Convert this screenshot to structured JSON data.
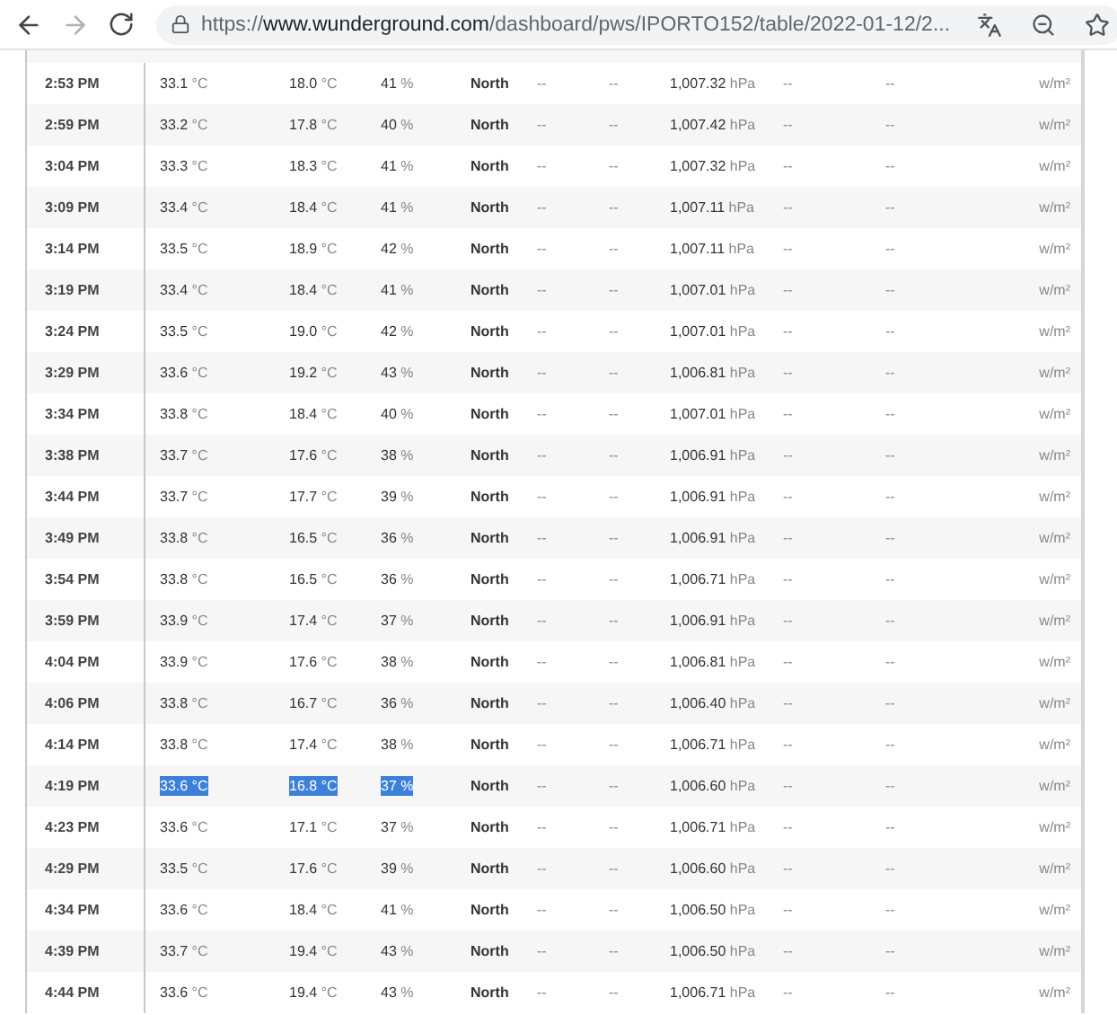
{
  "browser": {
    "url_scheme": "https://",
    "url_host": "www.wunderground.com",
    "url_path": "/dashboard/pws/IPORTO152/table/2022-01-12/2...",
    "forward_disabled": true
  },
  "table": {
    "rows": [
      {
        "time": "2:53 PM",
        "temperature": "33.1 °C",
        "dew_point": "18.0 °C",
        "humidity": "41 %",
        "wind": "North",
        "speed": "--",
        "gust": "--",
        "pressure": "1,007.32 hPa",
        "precip_rate": "--",
        "precip_accum": "--",
        "solar": "w/m²",
        "highlighted": false
      },
      {
        "time": "2:59 PM",
        "temperature": "33.2 °C",
        "dew_point": "17.8 °C",
        "humidity": "40 %",
        "wind": "North",
        "speed": "--",
        "gust": "--",
        "pressure": "1,007.42 hPa",
        "precip_rate": "--",
        "precip_accum": "--",
        "solar": "w/m²",
        "highlighted": false
      },
      {
        "time": "3:04 PM",
        "temperature": "33.3 °C",
        "dew_point": "18.3 °C",
        "humidity": "41 %",
        "wind": "North",
        "speed": "--",
        "gust": "--",
        "pressure": "1,007.32 hPa",
        "precip_rate": "--",
        "precip_accum": "--",
        "solar": "w/m²",
        "highlighted": false
      },
      {
        "time": "3:09 PM",
        "temperature": "33.4 °C",
        "dew_point": "18.4 °C",
        "humidity": "41 %",
        "wind": "North",
        "speed": "--",
        "gust": "--",
        "pressure": "1,007.11 hPa",
        "precip_rate": "--",
        "precip_accum": "--",
        "solar": "w/m²",
        "highlighted": false
      },
      {
        "time": "3:14 PM",
        "temperature": "33.5 °C",
        "dew_point": "18.9 °C",
        "humidity": "42 %",
        "wind": "North",
        "speed": "--",
        "gust": "--",
        "pressure": "1,007.11 hPa",
        "precip_rate": "--",
        "precip_accum": "--",
        "solar": "w/m²",
        "highlighted": false
      },
      {
        "time": "3:19 PM",
        "temperature": "33.4 °C",
        "dew_point": "18.4 °C",
        "humidity": "41 %",
        "wind": "North",
        "speed": "--",
        "gust": "--",
        "pressure": "1,007.01 hPa",
        "precip_rate": "--",
        "precip_accum": "--",
        "solar": "w/m²",
        "highlighted": false
      },
      {
        "time": "3:24 PM",
        "temperature": "33.5 °C",
        "dew_point": "19.0 °C",
        "humidity": "42 %",
        "wind": "North",
        "speed": "--",
        "gust": "--",
        "pressure": "1,007.01 hPa",
        "precip_rate": "--",
        "precip_accum": "--",
        "solar": "w/m²",
        "highlighted": false
      },
      {
        "time": "3:29 PM",
        "temperature": "33.6 °C",
        "dew_point": "19.2 °C",
        "humidity": "43 %",
        "wind": "North",
        "speed": "--",
        "gust": "--",
        "pressure": "1,006.81 hPa",
        "precip_rate": "--",
        "precip_accum": "--",
        "solar": "w/m²",
        "highlighted": false
      },
      {
        "time": "3:34 PM",
        "temperature": "33.8 °C",
        "dew_point": "18.4 °C",
        "humidity": "40 %",
        "wind": "North",
        "speed": "--",
        "gust": "--",
        "pressure": "1,007.01 hPa",
        "precip_rate": "--",
        "precip_accum": "--",
        "solar": "w/m²",
        "highlighted": false
      },
      {
        "time": "3:38 PM",
        "temperature": "33.7 °C",
        "dew_point": "17.6 °C",
        "humidity": "38 %",
        "wind": "North",
        "speed": "--",
        "gust": "--",
        "pressure": "1,006.91 hPa",
        "precip_rate": "--",
        "precip_accum": "--",
        "solar": "w/m²",
        "highlighted": false
      },
      {
        "time": "3:44 PM",
        "temperature": "33.7 °C",
        "dew_point": "17.7 °C",
        "humidity": "39 %",
        "wind": "North",
        "speed": "--",
        "gust": "--",
        "pressure": "1,006.91 hPa",
        "precip_rate": "--",
        "precip_accum": "--",
        "solar": "w/m²",
        "highlighted": false
      },
      {
        "time": "3:49 PM",
        "temperature": "33.8 °C",
        "dew_point": "16.5 °C",
        "humidity": "36 %",
        "wind": "North",
        "speed": "--",
        "gust": "--",
        "pressure": "1,006.91 hPa",
        "precip_rate": "--",
        "precip_accum": "--",
        "solar": "w/m²",
        "highlighted": false
      },
      {
        "time": "3:54 PM",
        "temperature": "33.8 °C",
        "dew_point": "16.5 °C",
        "humidity": "36 %",
        "wind": "North",
        "speed": "--",
        "gust": "--",
        "pressure": "1,006.71 hPa",
        "precip_rate": "--",
        "precip_accum": "--",
        "solar": "w/m²",
        "highlighted": false
      },
      {
        "time": "3:59 PM",
        "temperature": "33.9 °C",
        "dew_point": "17.4 °C",
        "humidity": "37 %",
        "wind": "North",
        "speed": "--",
        "gust": "--",
        "pressure": "1,006.91 hPa",
        "precip_rate": "--",
        "precip_accum": "--",
        "solar": "w/m²",
        "highlighted": false
      },
      {
        "time": "4:04 PM",
        "temperature": "33.9 °C",
        "dew_point": "17.6 °C",
        "humidity": "38 %",
        "wind": "North",
        "speed": "--",
        "gust": "--",
        "pressure": "1,006.81 hPa",
        "precip_rate": "--",
        "precip_accum": "--",
        "solar": "w/m²",
        "highlighted": false
      },
      {
        "time": "4:06 PM",
        "temperature": "33.8 °C",
        "dew_point": "16.7 °C",
        "humidity": "36 %",
        "wind": "North",
        "speed": "--",
        "gust": "--",
        "pressure": "1,006.40 hPa",
        "precip_rate": "--",
        "precip_accum": "--",
        "solar": "w/m²",
        "highlighted": false
      },
      {
        "time": "4:14 PM",
        "temperature": "33.8 °C",
        "dew_point": "17.4 °C",
        "humidity": "38 %",
        "wind": "North",
        "speed": "--",
        "gust": "--",
        "pressure": "1,006.71 hPa",
        "precip_rate": "--",
        "precip_accum": "--",
        "solar": "w/m²",
        "highlighted": false
      },
      {
        "time": "4:19 PM",
        "temperature": "33.6 °C",
        "dew_point": "16.8 °C",
        "humidity": "37 %",
        "wind": "North",
        "speed": "--",
        "gust": "--",
        "pressure": "1,006.60 hPa",
        "precip_rate": "--",
        "precip_accum": "--",
        "solar": "w/m²",
        "highlighted": true
      },
      {
        "time": "4:23 PM",
        "temperature": "33.6 °C",
        "dew_point": "17.1 °C",
        "humidity": "37 %",
        "wind": "North",
        "speed": "--",
        "gust": "--",
        "pressure": "1,006.71 hPa",
        "precip_rate": "--",
        "precip_accum": "--",
        "solar": "w/m²",
        "highlighted": false
      },
      {
        "time": "4:29 PM",
        "temperature": "33.5 °C",
        "dew_point": "17.6 °C",
        "humidity": "39 %",
        "wind": "North",
        "speed": "--",
        "gust": "--",
        "pressure": "1,006.60 hPa",
        "precip_rate": "--",
        "precip_accum": "--",
        "solar": "w/m²",
        "highlighted": false
      },
      {
        "time": "4:34 PM",
        "temperature": "33.6 °C",
        "dew_point": "18.4 °C",
        "humidity": "41 %",
        "wind": "North",
        "speed": "--",
        "gust": "--",
        "pressure": "1,006.50 hPa",
        "precip_rate": "--",
        "precip_accum": "--",
        "solar": "w/m²",
        "highlighted": false
      },
      {
        "time": "4:39 PM",
        "temperature": "33.7 °C",
        "dew_point": "19.4 °C",
        "humidity": "43 %",
        "wind": "North",
        "speed": "--",
        "gust": "--",
        "pressure": "1,006.50 hPa",
        "precip_rate": "--",
        "precip_accum": "--",
        "solar": "w/m²",
        "highlighted": false
      },
      {
        "time": "4:44 PM",
        "temperature": "33.6 °C",
        "dew_point": "19.4 °C",
        "humidity": "43 %",
        "wind": "North",
        "speed": "--",
        "gust": "--",
        "pressure": "1,006.71 hPa",
        "precip_rate": "--",
        "precip_accum": "--",
        "solar": "w/m²",
        "highlighted": false
      }
    ]
  }
}
